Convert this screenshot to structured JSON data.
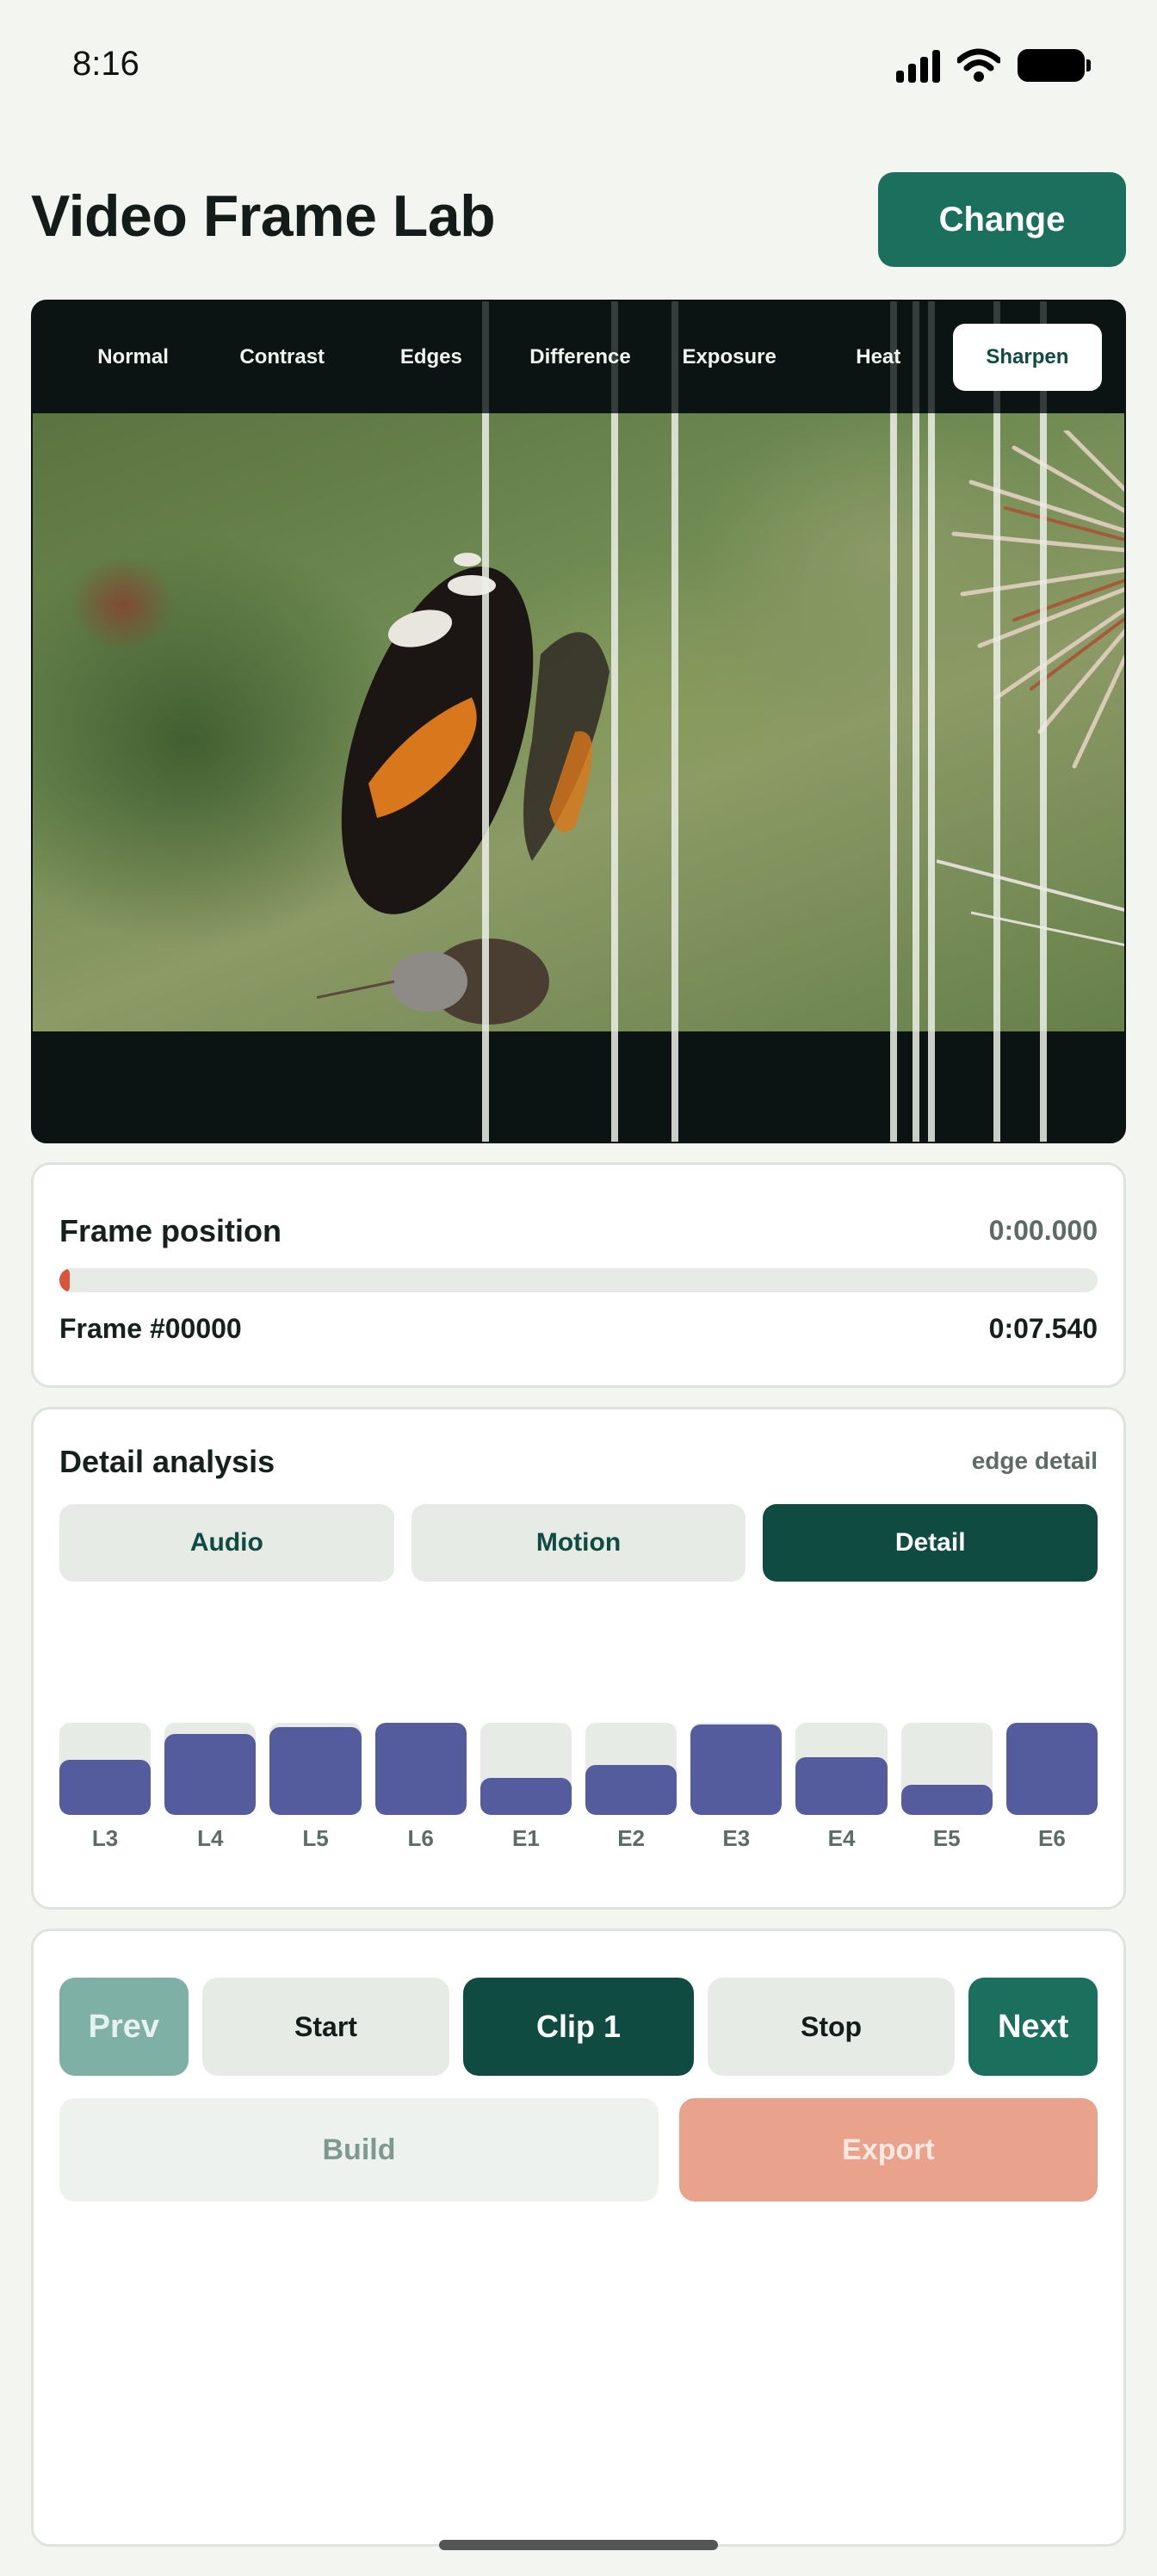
{
  "status_bar": {
    "time": "8:16",
    "icons": [
      "signal-icon",
      "wifi-icon",
      "battery-icon"
    ]
  },
  "header": {
    "title": "Video Frame Lab",
    "change_label": "Change"
  },
  "viewer": {
    "modes": [
      {
        "label": "Normal",
        "active": false
      },
      {
        "label": "Contrast",
        "active": false
      },
      {
        "label": "Edges",
        "active": false
      },
      {
        "label": "Difference",
        "active": false
      },
      {
        "label": "Exposure",
        "active": false
      },
      {
        "label": "Heat",
        "active": false
      },
      {
        "label": "Sharpen",
        "active": true
      }
    ]
  },
  "frame": {
    "title": "Frame position",
    "current_time": "0:00.000",
    "progress": 0.01,
    "frame_number": "Frame #00000",
    "duration": "0:07.540"
  },
  "analysis": {
    "title": "Detail analysis",
    "mode_label": "edge detail",
    "tabs": [
      {
        "label": "Audio",
        "active": false
      },
      {
        "label": "Motion",
        "active": false
      },
      {
        "label": "Detail",
        "active": true
      }
    ],
    "bars": [
      {
        "label": "L3",
        "value": 0.6
      },
      {
        "label": "L4",
        "value": 0.88
      },
      {
        "label": "L5",
        "value": 0.95
      },
      {
        "label": "L6",
        "value": 1.0
      },
      {
        "label": "E1",
        "value": 0.4
      },
      {
        "label": "E2",
        "value": 0.54
      },
      {
        "label": "E3",
        "value": 0.98
      },
      {
        "label": "E4",
        "value": 0.63
      },
      {
        "label": "E5",
        "value": 0.33
      },
      {
        "label": "E6",
        "value": 1.0
      }
    ]
  },
  "controls": {
    "prev": "Prev",
    "start": "Start",
    "clip": "Clip 1",
    "stop": "Stop",
    "next": "Next",
    "build": "Build",
    "export": "Export"
  },
  "colors": {
    "accent": "#1b6f5d",
    "accent_dark": "#0f4b40",
    "bar": "#545c9e",
    "progress": "#d8553b",
    "export": "#e9a28b"
  }
}
